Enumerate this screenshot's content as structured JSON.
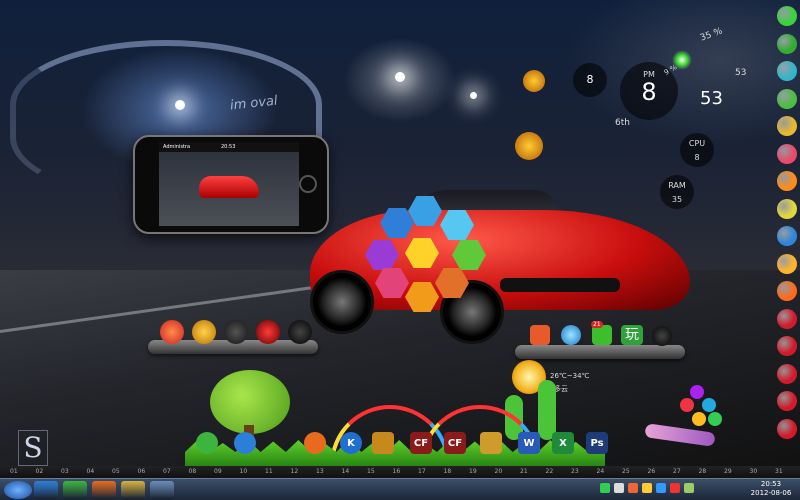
{
  "wallpaper": {
    "stadium_sign": "im oval"
  },
  "phone": {
    "status_left": "Administra",
    "status_time": "20:53"
  },
  "clock_gadget": {
    "period": "PM",
    "hour": "8",
    "minute": "53",
    "hour_small": "8",
    "minute_small": "53",
    "date_label": "6th",
    "percent_top": "35 %",
    "percent_side": "9 %"
  },
  "system_gadget": {
    "cpu_label": "CPU",
    "cpu_value": "8",
    "ram_label": "RAM",
    "ram_value": "35"
  },
  "weather_gadget": {
    "temperature": "26℃~34℃",
    "condition": "多云"
  },
  "desktop_icons": {
    "right_tray": [
      {
        "name": "msn-icon"
      },
      {
        "name": "music-note-icon"
      },
      {
        "name": "green-arrow-icon",
        "badge": "21"
      },
      {
        "name": "wan-game-icon",
        "text": "玩"
      },
      {
        "name": "black-face-icon"
      }
    ]
  },
  "dock": [
    {
      "name": "refresh-icon",
      "color": "#3db43d"
    },
    {
      "name": "internet-explorer-icon",
      "color": "#2b7fd8"
    },
    {
      "name": "firefox-icon",
      "color": "#e86a1c"
    },
    {
      "name": "k-app-icon",
      "color": "#1e6fd0",
      "text": "K"
    },
    {
      "name": "game-box-icon",
      "color": "#c7881e"
    },
    {
      "name": "crossfire-icon",
      "color": "#8b1a1a",
      "text": "CF"
    },
    {
      "name": "crossfire-icon-2",
      "color": "#8b1a1a",
      "text": "CF"
    },
    {
      "name": "race-game-icon",
      "color": "#cf9b2a"
    },
    {
      "name": "word-icon",
      "color": "#2a5ab8",
      "text": "W"
    },
    {
      "name": "excel-icon",
      "color": "#1f8a3a",
      "text": "X"
    },
    {
      "name": "photoshop-icon",
      "color": "#1f3c7a",
      "text": "Ps"
    }
  ],
  "ruler": {
    "marks": [
      "01",
      "02",
      "03",
      "04",
      "05",
      "06",
      "07",
      "08",
      "09",
      "10",
      "11",
      "12",
      "13",
      "14",
      "15",
      "16",
      "17",
      "18",
      "19",
      "20",
      "21",
      "22",
      "23",
      "24",
      "25",
      "26",
      "27",
      "28",
      "29",
      "30",
      "31"
    ]
  },
  "taskbar": {
    "clock_time": "20:53",
    "clock_date": "2012-08-06",
    "pinned": [
      {
        "name": "ie-taskbar-icon",
        "color": "#2b7fd8"
      },
      {
        "name": "360-taskbar-icon",
        "color": "#3db43d"
      },
      {
        "name": "firefox-taskbar-icon",
        "color": "#e86a1c"
      },
      {
        "name": "explorer-taskbar-icon",
        "color": "#d8b13a"
      },
      {
        "name": "media-player-taskbar-icon",
        "color": "#6a8bb8"
      }
    ]
  },
  "sidebar_icons": [
    {
      "name": "chat-icon",
      "color": "#3bd23b"
    },
    {
      "name": "green-app-icon",
      "color": "#2fae2f"
    },
    {
      "name": "video-app-icon",
      "color": "#31b5c9"
    },
    {
      "name": "security-icon",
      "color": "#4cbf40"
    },
    {
      "name": "tiles-app-icon",
      "color": "#e6b82d"
    },
    {
      "name": "flower-app-icon",
      "color": "#e94a6a"
    },
    {
      "name": "orange-app-icon",
      "color": "#ff8c1a"
    },
    {
      "name": "shield-icon",
      "color": "#e2d83c"
    },
    {
      "name": "browser-ball-icon",
      "color": "#2f86d8"
    },
    {
      "name": "smile-app-icon",
      "color": "#ffb52b"
    },
    {
      "name": "flame-ball-icon",
      "color": "#ff6a1a"
    },
    {
      "name": "ball-1",
      "color": "#d21a2a"
    },
    {
      "name": "ball-2",
      "color": "#d21a2a"
    },
    {
      "name": "ball-3",
      "color": "#d21a2a"
    },
    {
      "name": "ball-4",
      "color": "#d21a2a"
    },
    {
      "name": "ball-5",
      "color": "#d21a2a"
    }
  ],
  "logo_letter": "S"
}
